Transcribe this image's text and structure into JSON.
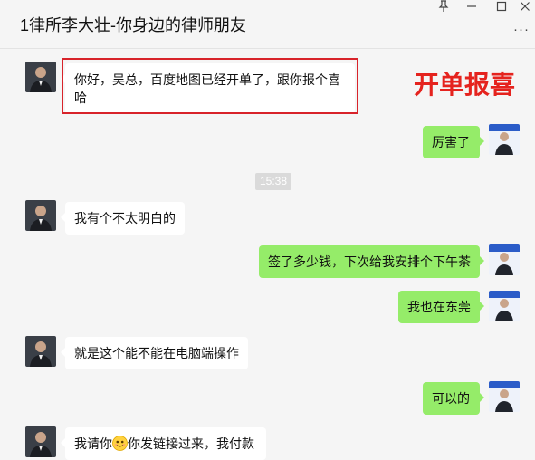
{
  "window": {
    "title": "1律所李大壮-你身边的律师朋友",
    "pin_icon": "pin-icon",
    "minimize_icon": "minimize-icon",
    "maximize_icon": "maximize-icon",
    "close_icon": "close-icon",
    "more_label": "···"
  },
  "annotation": {
    "label": "开单报喜",
    "color": "#e5231e"
  },
  "timestamp": "15:38",
  "messages": [
    {
      "side": "in",
      "text": "你好，吴总，百度地图已经开单了，跟你报个喜哈"
    },
    {
      "side": "out",
      "text": "厉害了"
    },
    {
      "side": "in",
      "text": "我有个不太明白的"
    },
    {
      "side": "out",
      "text": "签了多少钱，下次给我安排个下午茶"
    },
    {
      "side": "out",
      "text": "我也在东莞"
    },
    {
      "side": "in",
      "text": "就是这个能不能在电脑端操作"
    },
    {
      "side": "out",
      "text": "可以的"
    },
    {
      "side": "in",
      "text_before": "我请你",
      "emoji": "smile-emoji",
      "text_after": "你发链接过来，我付款"
    }
  ],
  "colors": {
    "background": "#f5f5f5",
    "incoming_bubble": "#ffffff",
    "outgoing_bubble": "#95ec69",
    "highlight": "#d8232a"
  }
}
